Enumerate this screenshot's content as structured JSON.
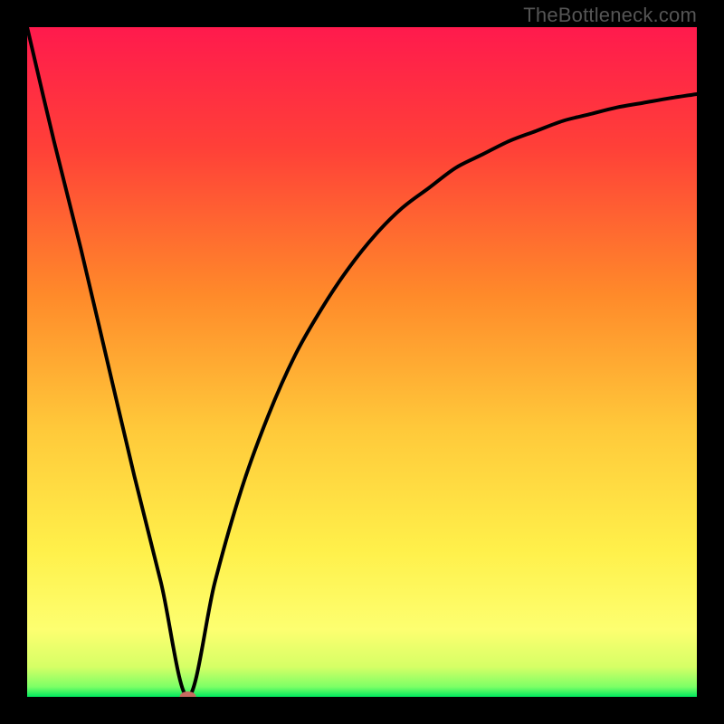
{
  "watermark": "TheBottleneck.com",
  "chart_data": {
    "type": "line",
    "title": "",
    "xlabel": "",
    "ylabel": "",
    "xlim": [
      0,
      100
    ],
    "ylim": [
      0,
      100
    ],
    "x_min_at": 24,
    "curve": {
      "name": "bottleneck-curve",
      "x": [
        0,
        4,
        8,
        12,
        16,
        20,
        24,
        28,
        32,
        36,
        40,
        44,
        48,
        52,
        56,
        60,
        64,
        68,
        72,
        76,
        80,
        84,
        88,
        92,
        96,
        100
      ],
      "y": [
        100,
        83,
        67,
        50,
        33,
        17,
        0,
        17,
        31,
        42,
        51,
        58,
        64,
        69,
        73,
        76,
        79,
        81,
        83,
        84.5,
        86,
        87,
        88,
        88.7,
        89.4,
        90
      ]
    },
    "marker": {
      "x": 24,
      "y": 0,
      "color": "#c76a60"
    },
    "background_gradient": {
      "stops": [
        {
          "offset": 0.0,
          "color": "#ff1a4d"
        },
        {
          "offset": 0.18,
          "color": "#ff4038"
        },
        {
          "offset": 0.4,
          "color": "#ff8a2a"
        },
        {
          "offset": 0.6,
          "color": "#ffc93a"
        },
        {
          "offset": 0.78,
          "color": "#fff04a"
        },
        {
          "offset": 0.9,
          "color": "#fdff70"
        },
        {
          "offset": 0.955,
          "color": "#d6ff66"
        },
        {
          "offset": 0.985,
          "color": "#7dff66"
        },
        {
          "offset": 1.0,
          "color": "#00e85e"
        }
      ]
    }
  }
}
